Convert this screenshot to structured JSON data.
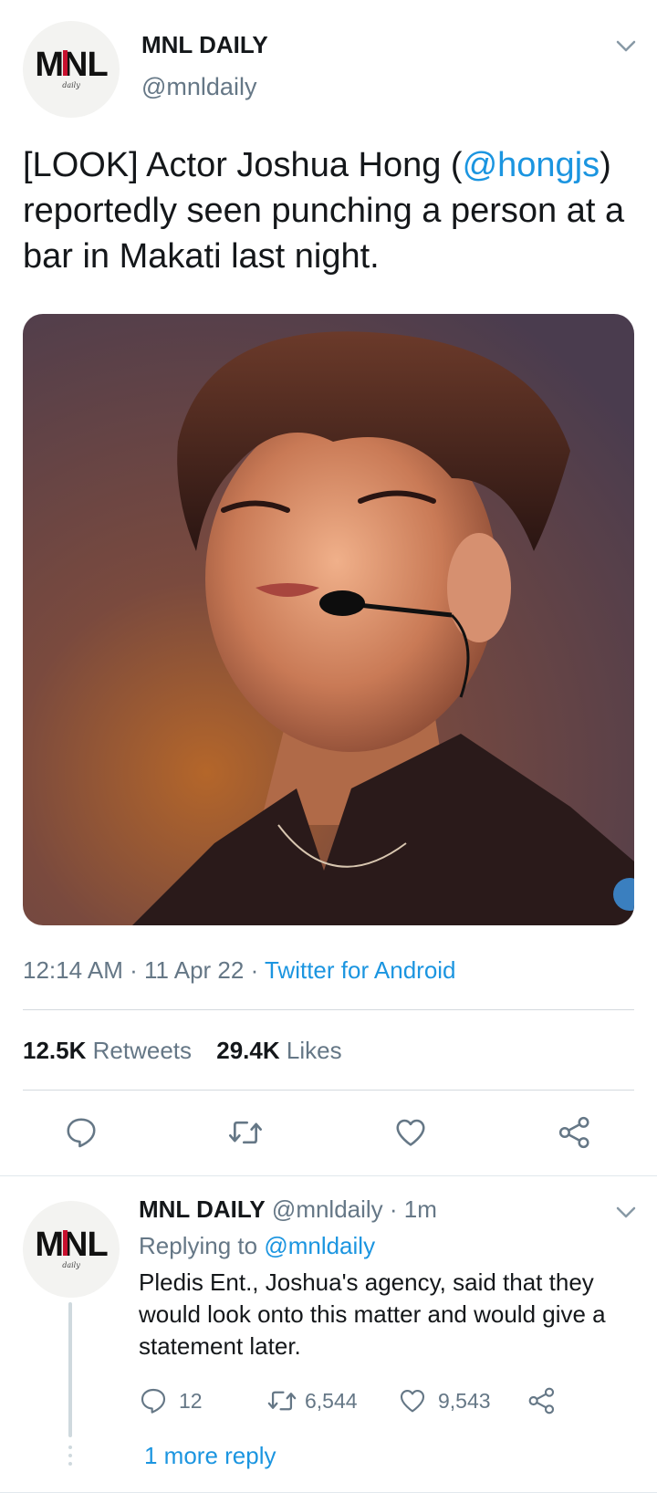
{
  "tweet": {
    "avatar_logo": {
      "text_top": "MNL",
      "text_bottom": "daily"
    },
    "author_name": "MNL DAILY",
    "author_handle": "@mnldaily",
    "text_part1": "[LOOK] Actor Joshua Hong (",
    "text_mention": "@hongjs",
    "text_part2": ") reportedly seen punching a person at a bar in Makati last night.",
    "time": "12:14 AM · 11 Apr 22 · ",
    "source": "Twitter for Android",
    "retweets_count": "12.5K",
    "retweets_label": "Retweets",
    "likes_count": "29.4K",
    "likes_label": "Likes",
    "actions": [
      "reply-icon",
      "retweet-icon",
      "like-icon",
      "share-icon"
    ]
  },
  "reply": {
    "author_name": "MNL DAILY",
    "author_handle": "@mnldaily",
    "time": "· 1m",
    "replying_label": "Replying to ",
    "replying_handle": "@mnldaily",
    "text": "Pledis Ent., Joshua's agency, said that they would look onto this matter and would give a statement later.",
    "reply_count": "12",
    "retweet_count": "6,544",
    "like_count": "9,543",
    "more_replies": "1 more reply"
  },
  "colors": {
    "accent": "#1b95e0",
    "muted": "#657786",
    "icon": "#657786",
    "thread_line": "#cfd9de",
    "logo_red": "#c8102e"
  }
}
